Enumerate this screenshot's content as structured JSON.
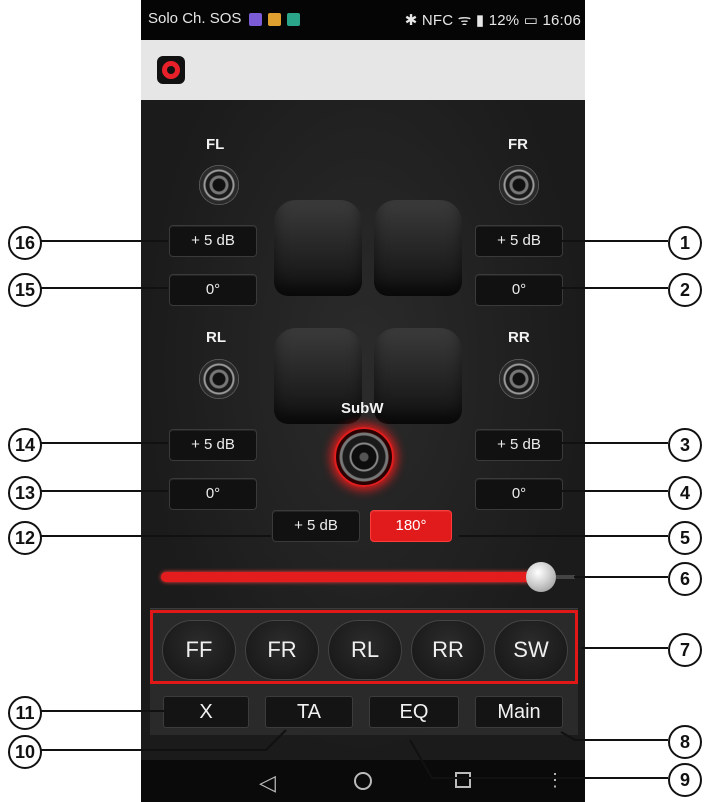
{
  "status_bar": {
    "carrier": "Solo Ch. SOS",
    "right": "✱ NFC ᯤ ▮ 12% ▭ 16:06",
    "battery": "12%",
    "time": "16:06"
  },
  "channels": {
    "fl": {
      "label": "FL",
      "gain": "+ 5 dB",
      "phase": "0°"
    },
    "fr": {
      "label": "FR",
      "gain": "+ 5 dB",
      "phase": "0°"
    },
    "rl": {
      "label": "RL",
      "gain": "+ 5 dB",
      "phase": "0°"
    },
    "rr": {
      "label": "RR",
      "gain": "+ 5 dB",
      "phase": "0°"
    },
    "subw": {
      "label": "SubW",
      "gain": "+ 5 dB",
      "phase": "180°"
    }
  },
  "slider": {
    "level": 0.95,
    "accent": "#e31d1d"
  },
  "channel_buttons": [
    "FF",
    "FR",
    "RL",
    "RR",
    "SW"
  ],
  "menu_buttons": {
    "x": "X",
    "ta": "TA",
    "eq": "EQ",
    "main": "Main"
  },
  "callouts": [
    "1",
    "2",
    "3",
    "4",
    "5",
    "6",
    "7",
    "8",
    "9",
    "10",
    "11",
    "12",
    "13",
    "14",
    "15",
    "16"
  ],
  "colors": {
    "accent": "#e31d1d",
    "background": "#1e1e1e"
  }
}
